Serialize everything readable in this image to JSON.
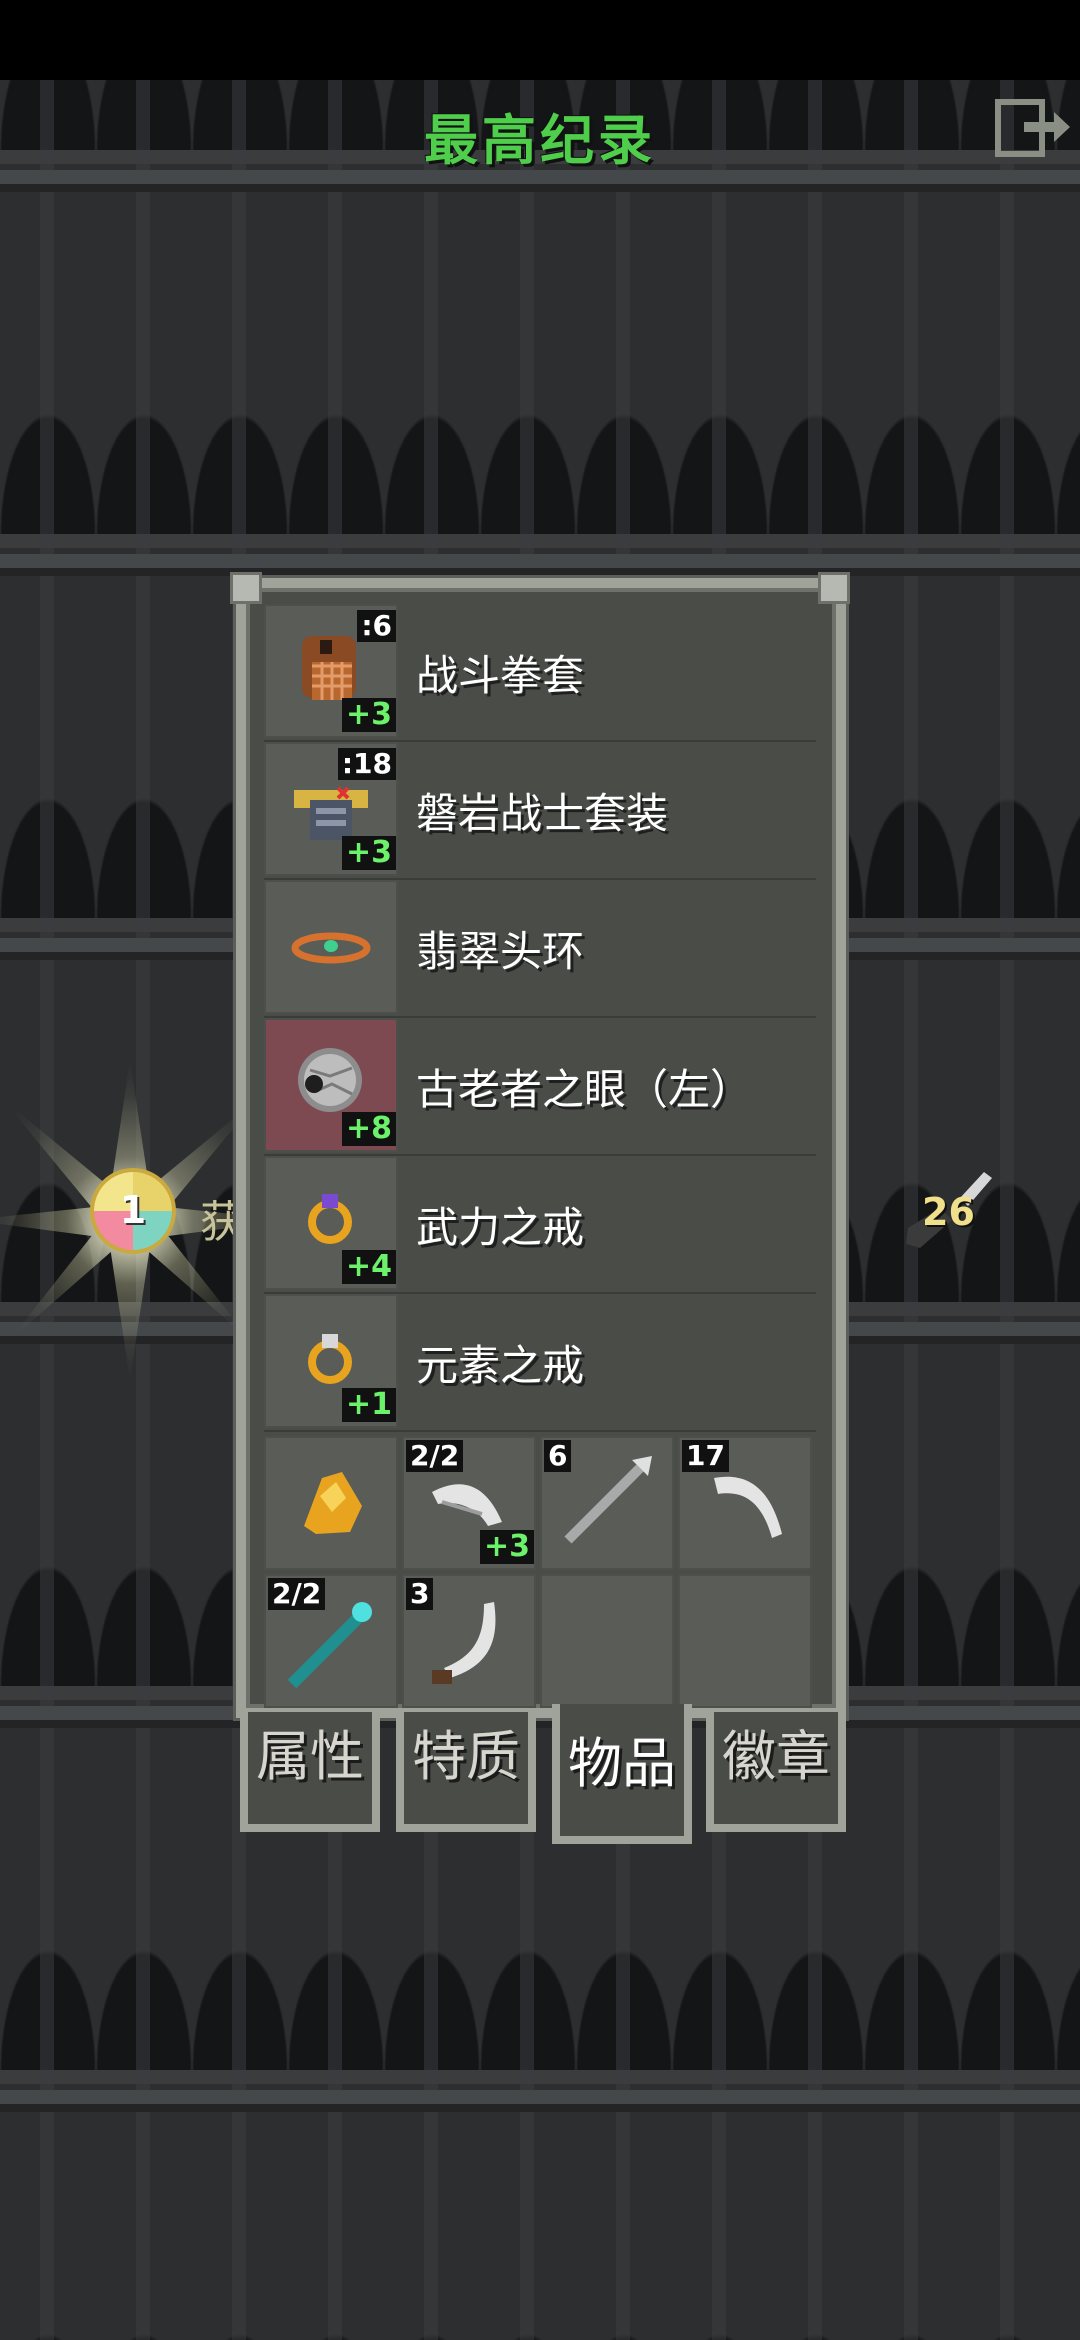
{
  "header": {
    "title": "最高纪录",
    "exit_icon": "exit-icon"
  },
  "side": {
    "score_value": "1",
    "label": "获",
    "right_item_qty": "26"
  },
  "items": [
    {
      "name": "战斗拳套",
      "qty": ":6",
      "level": "+3",
      "icon": "gauntlet-icon",
      "highlight": false
    },
    {
      "name": "磐岩战士套装",
      "qty": ":18",
      "level": "+3",
      "icon": "armor-icon",
      "highlight": false
    },
    {
      "name": "翡翠头环",
      "qty": "",
      "level": "",
      "icon": "circlet-icon",
      "highlight": false
    },
    {
      "name": "古老者之眼（左）",
      "qty": "",
      "level": "+8",
      "icon": "eye-orb-icon",
      "highlight": true
    },
    {
      "name": "武力之戒",
      "qty": "",
      "level": "+4",
      "icon": "ring-icon",
      "highlight": false
    },
    {
      "name": "元素之戒",
      "qty": "",
      "level": "+1",
      "icon": "ring-icon",
      "highlight": false
    }
  ],
  "grid": [
    {
      "icon": "gold-pile-icon",
      "qty": "",
      "level": ""
    },
    {
      "icon": "wing-icon",
      "qty": "2/2",
      "level": "+3"
    },
    {
      "icon": "dart-icon",
      "qty": "6",
      "level": ""
    },
    {
      "icon": "boomerang-icon",
      "qty": "17",
      "level": ""
    },
    {
      "icon": "wand-icon",
      "qty": "2/2",
      "level": ""
    },
    {
      "icon": "sickle-icon",
      "qty": "3",
      "level": ""
    },
    {
      "icon": "",
      "qty": "",
      "level": ""
    },
    {
      "icon": "",
      "qty": "",
      "level": ""
    }
  ],
  "tabs": [
    {
      "label": "属性",
      "active": false
    },
    {
      "label": "特质",
      "active": false
    },
    {
      "label": "物品",
      "active": true
    },
    {
      "label": "徽章",
      "active": false
    }
  ],
  "colors": {
    "title": "#4fce4b",
    "level": "#6cf26a",
    "highlight_slot": "#7d4a52"
  }
}
